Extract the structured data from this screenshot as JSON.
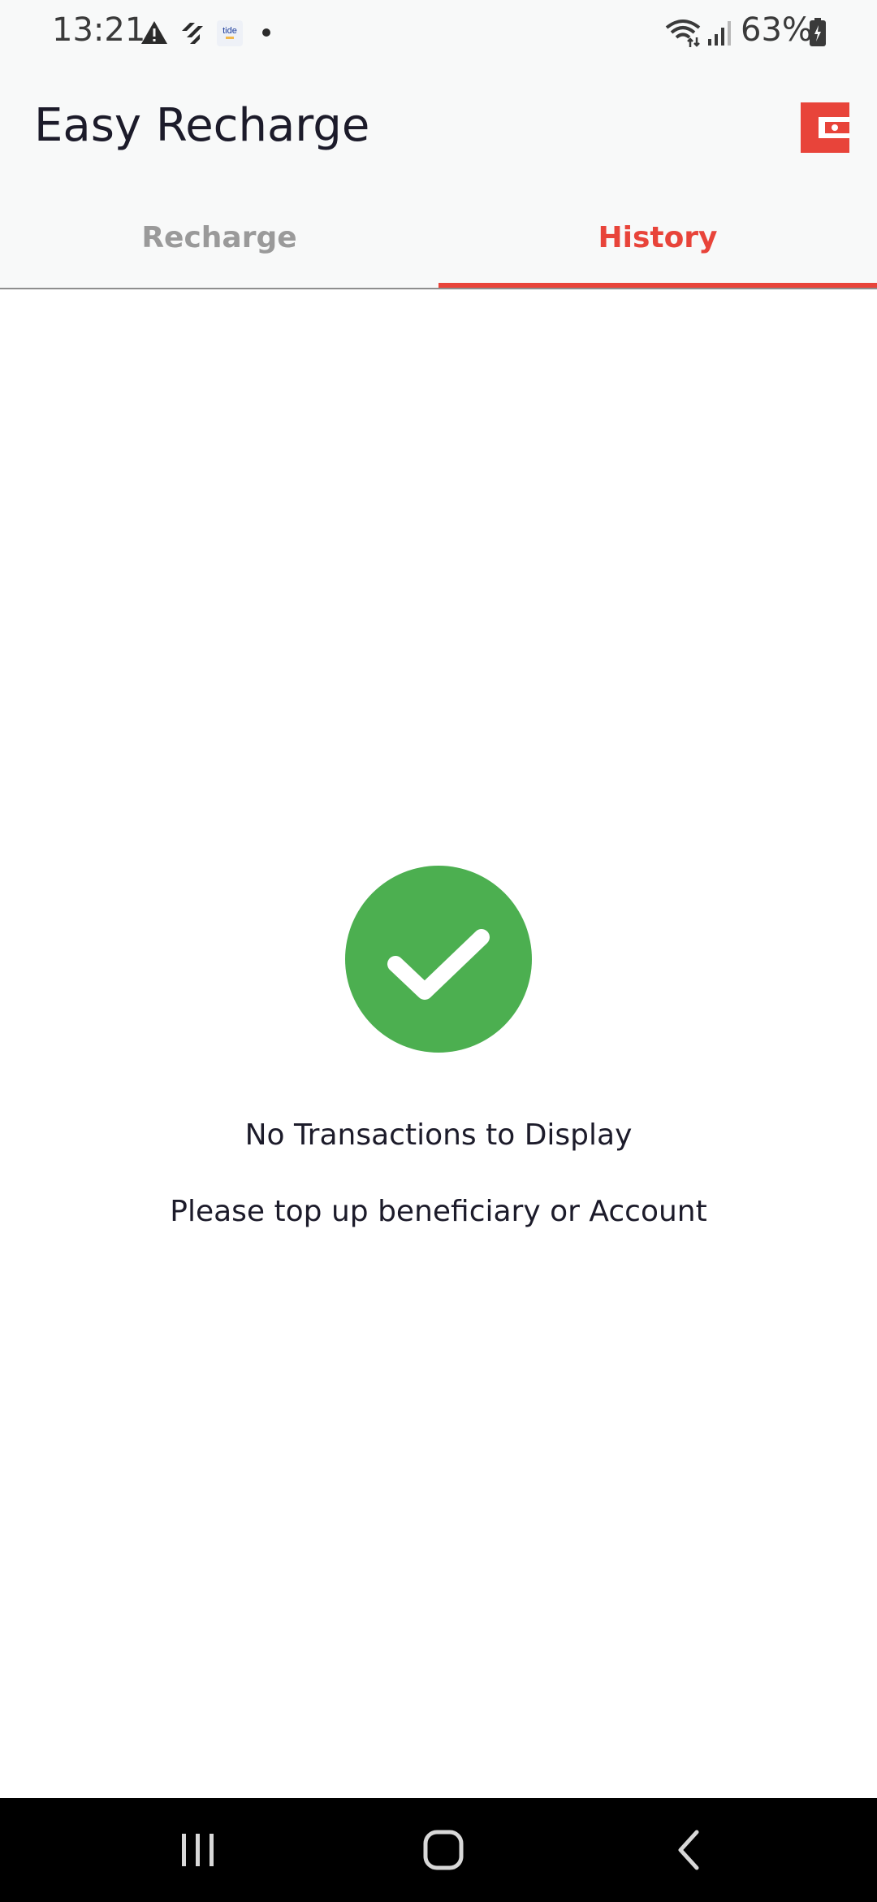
{
  "status_bar": {
    "time": "13:21",
    "battery_percent": "63%",
    "icons": [
      "warning-icon",
      "app-notification-icon",
      "tide-notification-icon",
      "more-dot-icon",
      "wifi-icon",
      "signal-icon",
      "battery-icon"
    ]
  },
  "app_bar": {
    "title": "Easy Recharge",
    "action_icon": "wallet-icon"
  },
  "tabs": [
    {
      "label": "Recharge",
      "selected": false
    },
    {
      "label": "History",
      "selected": true
    }
  ],
  "empty_state": {
    "icon": "check-circle-icon",
    "title": "No Transactions to Display",
    "subtitle": "Please top up beneficiary or Account"
  },
  "nav_bar": {
    "buttons": [
      "recent-apps-icon",
      "home-icon",
      "back-icon"
    ]
  },
  "colors": {
    "accent": "#e8443a",
    "success": "#4caf50",
    "tab_inactive": "#9a9a9a",
    "surface": "#f8f9f9"
  }
}
